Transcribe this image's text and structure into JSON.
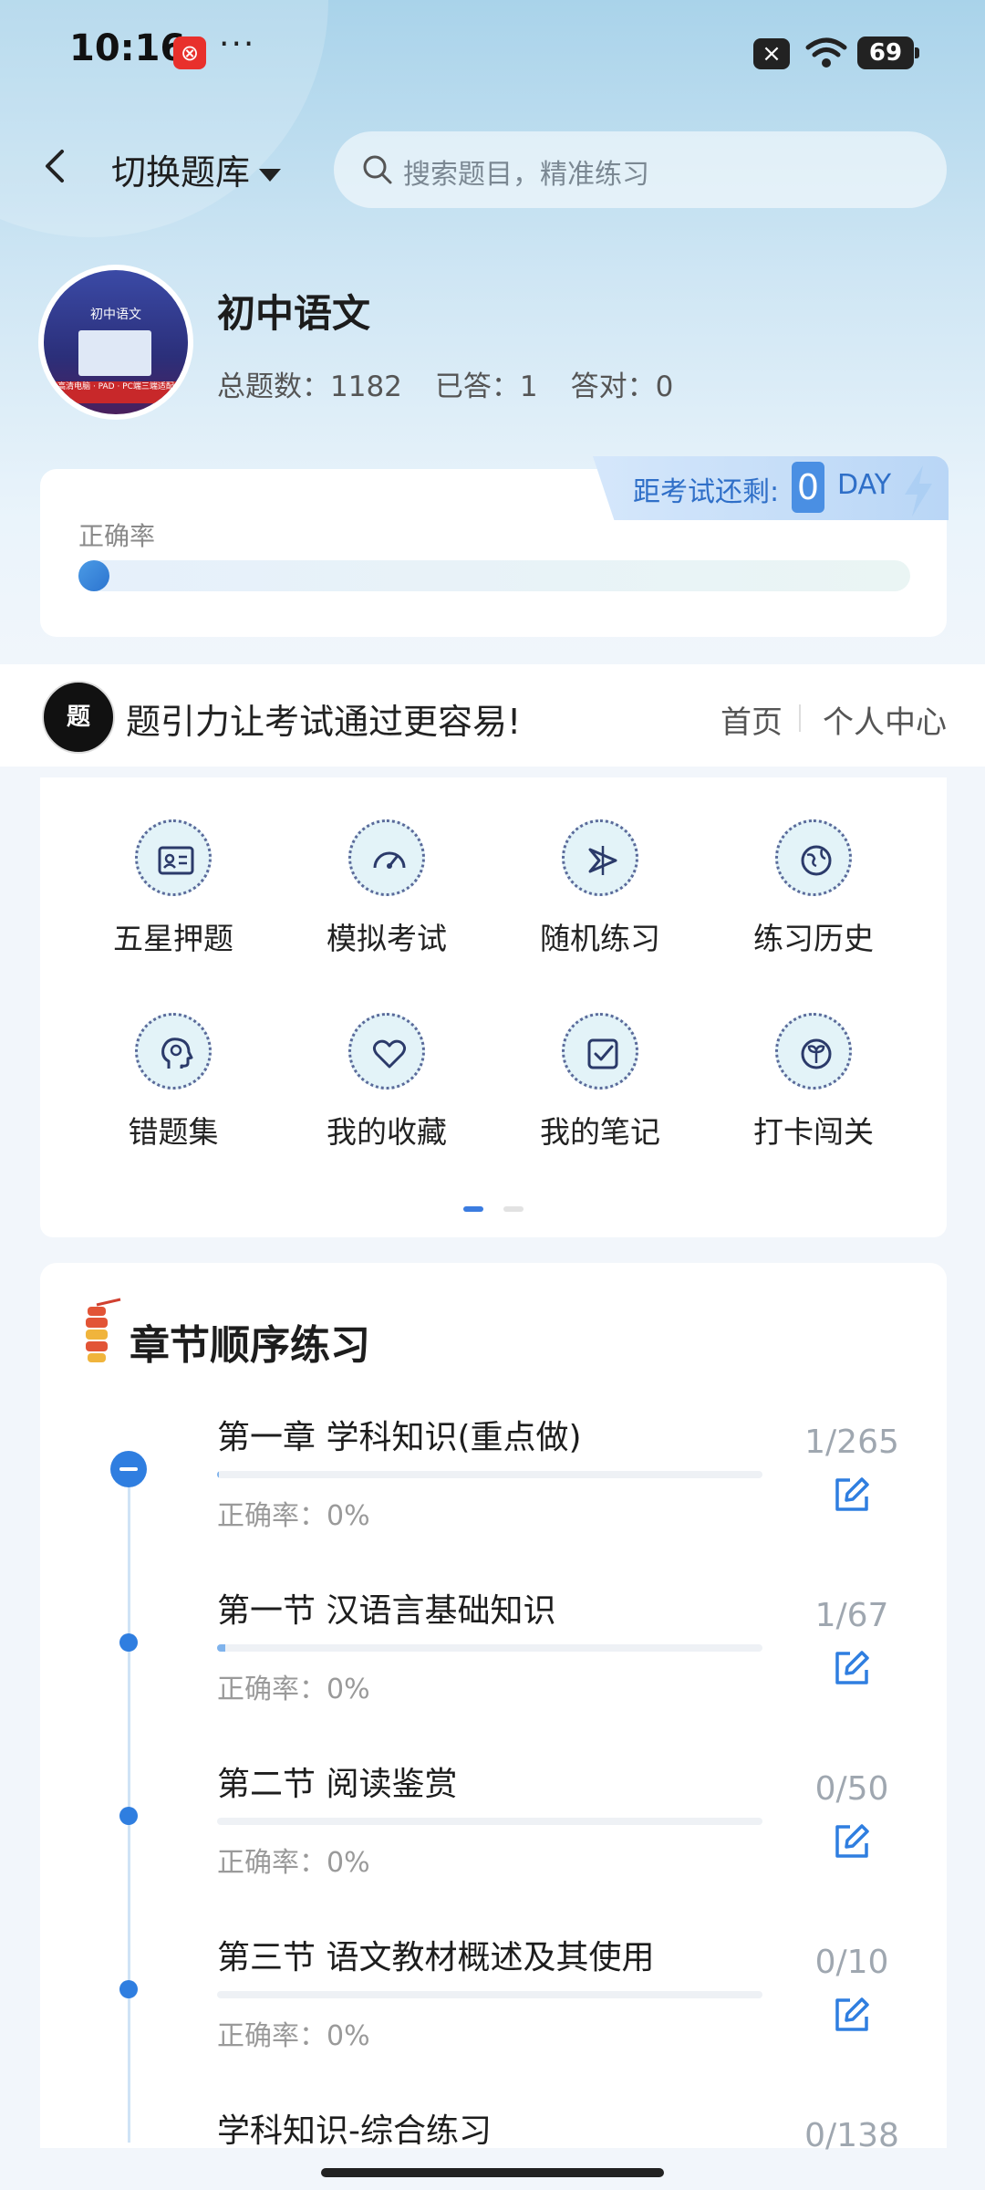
{
  "status_bar": {
    "time": "10:16",
    "app_badge": "⊗",
    "more": "···",
    "battery": "69"
  },
  "header": {
    "switch_label": "切换题库",
    "search_placeholder": "搜索题目，精准练习"
  },
  "subject": {
    "avatar_title": "初中语文",
    "avatar_band": "高清电脑 · PAD · PC端三端适配",
    "title": "初中语文",
    "total_label": "总题数：1182",
    "answered_label": "已答：1",
    "correct_label": "答对：0"
  },
  "accuracy": {
    "label": "正确率",
    "value": 0,
    "countdown_label": "距考试还剩:",
    "countdown_value": "0",
    "countdown_unit": "DAY"
  },
  "promo": {
    "logo": "题引力",
    "text": "题引力让考试通过更容易!",
    "home": "首页",
    "personal": "个人中心"
  },
  "functions": [
    {
      "label": "五星押题",
      "icon": "id-card-icon"
    },
    {
      "label": "模拟考试",
      "icon": "gauge-icon"
    },
    {
      "label": "随机练习",
      "icon": "random-icon"
    },
    {
      "label": "练习历史",
      "icon": "globe-icon"
    },
    {
      "label": "错题集",
      "icon": "head-icon"
    },
    {
      "label": "我的收藏",
      "icon": "heart-icon"
    },
    {
      "label": "我的笔记",
      "icon": "note-check-icon"
    },
    {
      "label": "打卡闯关",
      "icon": "leaf-icon"
    }
  ],
  "pager": {
    "current": 1,
    "total": 2
  },
  "chapters_section": {
    "title": "章节顺序练习",
    "items": [
      {
        "name": "第一章 学科知识(重点做)",
        "accuracy": "正确率：0%",
        "count": "1/265",
        "progress": 0.004
      },
      {
        "name": "第一节 汉语言基础知识",
        "accuracy": "正确率：0%",
        "count": "1/67",
        "progress": 0.015
      },
      {
        "name": "第二节 阅读鉴赏",
        "accuracy": "正确率：0%",
        "count": "0/50",
        "progress": 0
      },
      {
        "name": "第三节 语文教材概述及其使用",
        "accuracy": "正确率：0%",
        "count": "0/10",
        "progress": 0
      },
      {
        "name": "学科知识-综合练习",
        "accuracy": "",
        "count": "0/138",
        "progress": 0
      }
    ]
  }
}
